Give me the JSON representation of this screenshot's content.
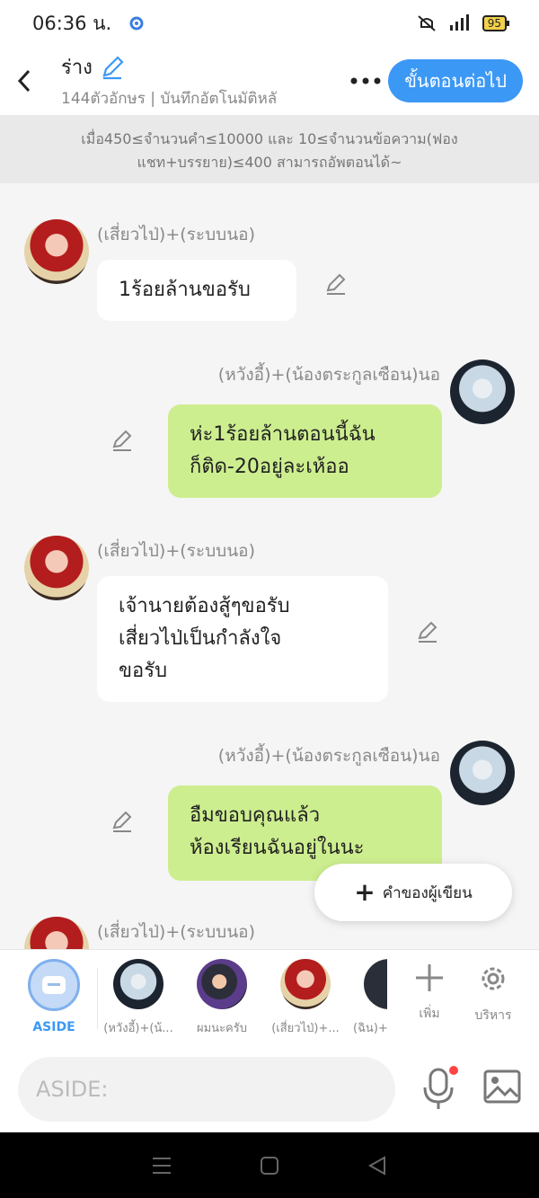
{
  "status_bar": {
    "time": "06:36 น.",
    "battery": "95"
  },
  "header": {
    "title": "ร่าง",
    "subtitle": "144ตัวอักษร | บันทึกอัตโนมัติหลั",
    "next_button": "ขั้นตอนต่อไป"
  },
  "notice": {
    "text": "เมื่อ450≤จำนวนคำ≤10000 และ 10≤จำนวนข้อความ(ฟองแชท+บรรยาย)≤400 สามารถอัพตอนได้~"
  },
  "messages": [
    {
      "side": "left",
      "sender": "(เสี่ยวไป่)+(ระบบนอ)",
      "lines": [
        "1ร้อยล้านขอรับ"
      ]
    },
    {
      "side": "right",
      "sender": "(หวังอี้)+(น้องตระกูลเซือน)นอ",
      "lines": [
        "ห่ะ1ร้อยล้านตอนนี้ฉัน",
        "ก็ติด-20อยู่ละเห้ออ"
      ]
    },
    {
      "side": "left",
      "sender": "(เสี่ยวไป่)+(ระบบนอ)",
      "lines": [
        "เจ้านายต้องสู้ๆขอรับ",
        "เสี่ยวไป่เป็นกำลังใจ",
        "ขอรับ"
      ]
    },
    {
      "side": "right",
      "sender": "(หวังอี้)+(น้องตระกูลเซือน)นอ",
      "lines": [
        "อืมขอบคุณแล้ว",
        "ห้องเรียนฉันอยู่ในนะ"
      ]
    },
    {
      "side": "left",
      "sender": "(เสี่ยวไป่)+(ระบบนอ)",
      "lines": []
    }
  ],
  "author_note_button": "คำของผู้เขียน",
  "characters": {
    "aside_label": "ASIDE",
    "items": [
      {
        "label": "(หวังอี้)+(น้...",
        "avatar": "white-hair-avatar"
      },
      {
        "label": "ผมนะครับ",
        "avatar": "boy-avatar"
      },
      {
        "label": "(เสี่ยวไป่)+...",
        "avatar": "red-hair-avatar"
      },
      {
        "label": "(ฉิน)+",
        "avatar": "dark-avatar"
      }
    ],
    "add_label": "เพิ่ม",
    "manage_label": "บริหาร"
  },
  "input": {
    "placeholder": "ASIDE:"
  }
}
